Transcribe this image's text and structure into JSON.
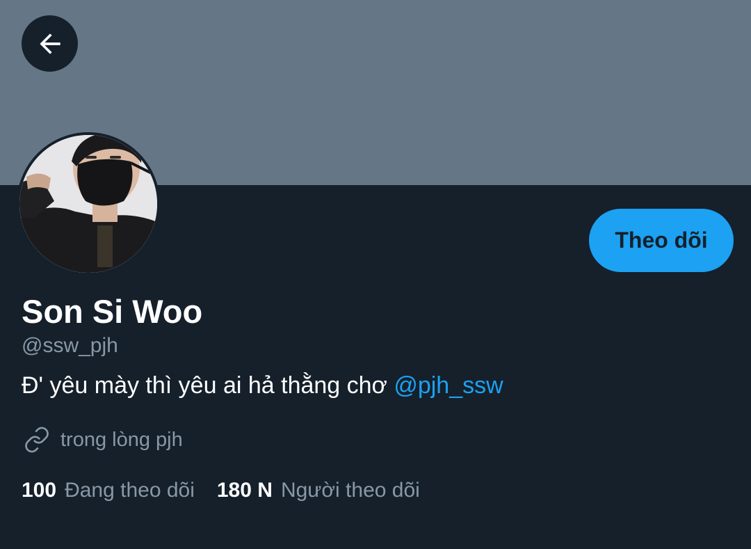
{
  "header": {
    "back_icon": "arrow-left-icon"
  },
  "profile": {
    "avatar_description": "profile-photo",
    "follow_label": "Theo dõi",
    "display_name": "Son Si Woo",
    "handle": "@ssw_pjh",
    "bio_text": "Đ' yêu mày thì yêu ai hả thằng chơ ",
    "bio_mention": "@pjh_ssw",
    "website_icon": "link-icon",
    "website": "trong lòng pjh"
  },
  "stats": {
    "following_count": "100",
    "following_label": "Đang theo dõi",
    "followers_count": "180 N",
    "followers_label": "Người theo dõi"
  },
  "colors": {
    "banner": "#657786",
    "background": "#15202b",
    "accent": "#1da1f2",
    "secondary_text": "#8899a6"
  }
}
